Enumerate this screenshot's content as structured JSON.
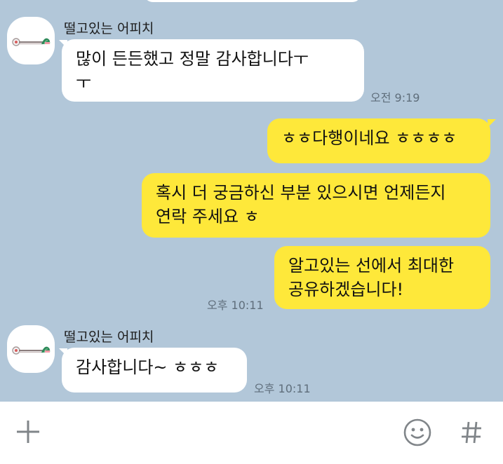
{
  "conversation": {
    "contact_name": "떨고있는 어피치",
    "messages": [
      {
        "sender": "떨고있는 어피치",
        "direction": "in",
        "lines": [
          "많이 든든했고 정말 감사합니다ㅜ",
          "ㅜ"
        ],
        "time": "오전 9:19"
      },
      {
        "direction": "out",
        "lines": [
          "ㅎㅎ다행이네요 ㅎㅎㅎㅎ"
        ]
      },
      {
        "direction": "out",
        "lines": [
          "혹시 더 궁금하신 부분 있으시면 언제든지",
          "연락 주세요 ㅎ"
        ]
      },
      {
        "direction": "out",
        "lines": [
          "알고있는 선에서 최대한",
          "공유하겠습니다!"
        ],
        "time": "오후 10:11"
      },
      {
        "sender": "떨고있는 어피치",
        "direction": "in",
        "lines": [
          "감사합니다~ ㅎㅎㅎ"
        ],
        "time": "오후 10:11"
      }
    ]
  },
  "input_bar": {
    "add_icon": "plus-icon",
    "emoji_icon": "smiley-icon",
    "hashtag_icon": "hashtag-icon"
  },
  "colors": {
    "chat_background": "#b2c7d9",
    "incoming_bubble": "#ffffff",
    "outgoing_bubble": "#fee83a",
    "timestamp": "#5f6e7b",
    "input_icons": "#808589"
  }
}
